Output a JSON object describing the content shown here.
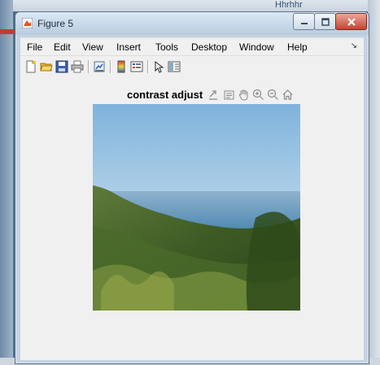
{
  "window": {
    "title": "Figure 5"
  },
  "menubar": {
    "items": [
      {
        "label": "File"
      },
      {
        "label": "Edit"
      },
      {
        "label": "View"
      },
      {
        "label": "Insert"
      },
      {
        "label": "Tools"
      },
      {
        "label": "Desktop"
      },
      {
        "label": "Window"
      },
      {
        "label": "Help"
      }
    ],
    "overflow_glyph": "↘"
  },
  "toolbar": {
    "buttons": [
      {
        "icon": "new-figure-icon"
      },
      {
        "icon": "open-file-icon"
      },
      {
        "icon": "save-icon"
      },
      {
        "icon": "print-icon"
      },
      {
        "icon": "link-plot-icon"
      },
      {
        "icon": "insert-colorbar-icon"
      },
      {
        "icon": "insert-legend-icon"
      },
      {
        "icon": "edit-plot-icon"
      },
      {
        "icon": "show-plot-tools-icon"
      }
    ]
  },
  "axes": {
    "title": "contrast adjust",
    "toolbar_icons": [
      "export-icon",
      "brush-icon",
      "pan-icon",
      "zoom-in-icon",
      "zoom-out-icon",
      "home-icon"
    ]
  },
  "background": {
    "partial_text": "Hhrhhr"
  },
  "colors": {
    "titlebar": "#c4d3e2",
    "close_button": "#c8422f",
    "panel": "#f0f0f0"
  }
}
